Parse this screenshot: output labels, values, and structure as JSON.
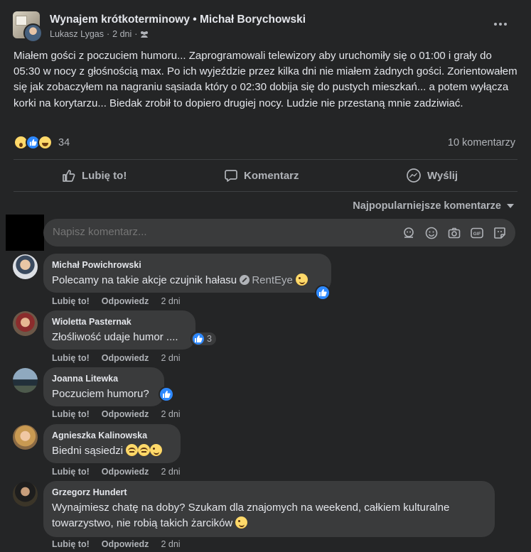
{
  "post": {
    "group_name": "Wynajem krótkoterminowy • Michał Borychowski",
    "author": "Lukasz Lygas",
    "time": "2 dni",
    "separator": "·",
    "body": "Miałem gości z poczuciem humoru... Zaprogramowali telewizory aby uruchomiły się o 01:00 i grały do 05:30  w nocy z głośnością max. Po ich wyjeździe przez kilka dni nie miałem żadnych gości. Zorientowałem się jak zobaczyłem na nagraniu sąsiada który o 02:30 dobija się do pustych mieszkań... a potem wyłącza korki na korytarzu... Biedak zrobił to dopiero drugiej nocy. Ludzie nie przestaną mnie zadziwiać.",
    "reaction_count": "34",
    "comment_count": "10 komentarzy"
  },
  "actions": {
    "like": "Lubię to!",
    "comment": "Komentarz",
    "send": "Wyślij"
  },
  "sort_label": "Najpopularniejsze komentarze",
  "composer": {
    "placeholder": "Napisz komentarz..."
  },
  "comment_actions": {
    "like": "Lubię to!",
    "reply": "Odpowiedz"
  },
  "comments": [
    {
      "name": "Michał Powichrowski",
      "text": "Polecamy na takie akcje czujnik hałasu",
      "link": "RentEye",
      "time": "2 dni"
    },
    {
      "name": "Wioletta Pasternak",
      "text": "Złośliwość udaje humor ....",
      "likes": "3",
      "time": "2 dni"
    },
    {
      "name": "Joanna Litewka",
      "text": "Poczuciem humoru?",
      "time": "2 dni"
    },
    {
      "name": "Agnieszka Kalinowska",
      "text": "Biedni sąsiedzi",
      "time": "2 dni"
    },
    {
      "name": "Grzegorz Hundert",
      "text": "Wynajmiesz chatę na doby? Szukam dla znajomych na weekend, całkiem kulturalne towarzystwo, nie robią takich żarcików",
      "time": "2 dni"
    }
  ],
  "colors": {
    "background": "#242526",
    "bubble": "#3a3b3c",
    "text": "#e4e6eb",
    "secondary_text": "#b0b3b8",
    "like_blue": "#2e89ff"
  }
}
